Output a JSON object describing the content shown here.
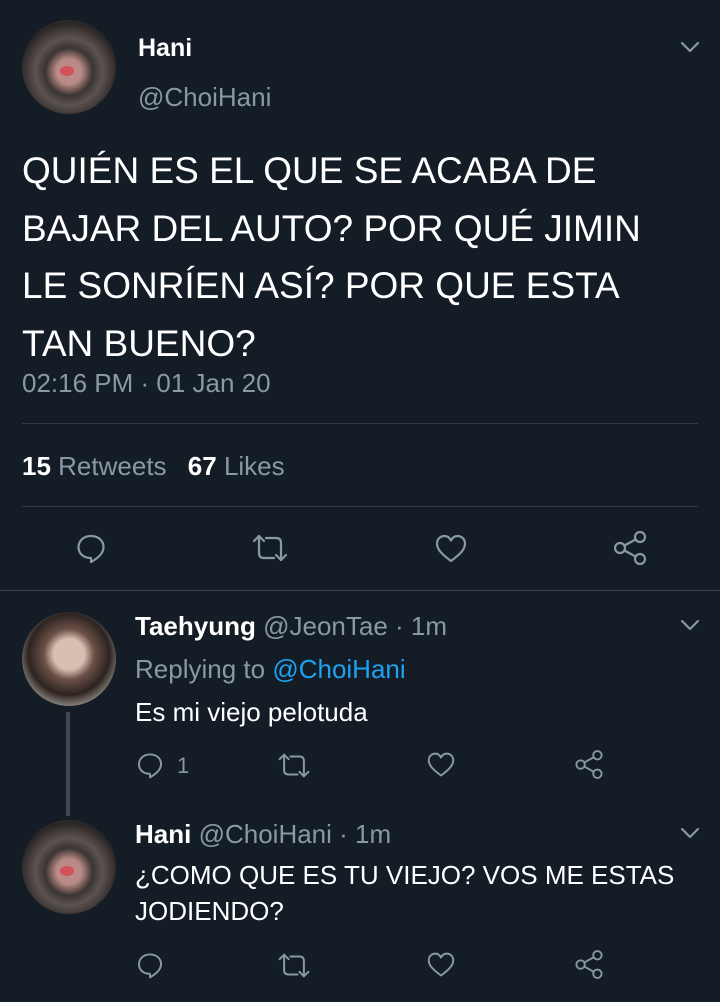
{
  "main_tweet": {
    "name": "Hani",
    "handle": "@ChoiHani",
    "text": "QUIÉN ES EL QUE SE ACABA DE BAJAR DEL AUTO? POR QUÉ JIMIN LE SONRÍEN ASÍ? POR QUE ESTA TAN BUENO?",
    "timestamp": "02:16 PM · 01 Jan 20",
    "retweets_count": "15",
    "retweets_label": "Retweets",
    "likes_count": "67",
    "likes_label": "Likes"
  },
  "replies": [
    {
      "name": "Taehyung",
      "handle": "@JeonTae",
      "time": "· 1m",
      "replying_prefix": "Replying to",
      "replying_handle": "@ChoiHani",
      "text": "Es mi viejo pelotuda",
      "reply_count": "1"
    },
    {
      "name": "Hani",
      "handle": "@ChoiHani",
      "time": "· 1m",
      "text": "¿COMO QUE ES TU VIEJO? VOS ME ESTAS JODIENDO?"
    }
  ],
  "icons": {
    "reply": "reply-icon",
    "retweet": "retweet-icon",
    "like": "heart-icon",
    "share": "share-icon",
    "more": "chevron-down-icon"
  },
  "colors": {
    "background": "#141d26",
    "muted": "#8899a6",
    "link": "#1da1f2",
    "divider": "#2f3b47"
  }
}
